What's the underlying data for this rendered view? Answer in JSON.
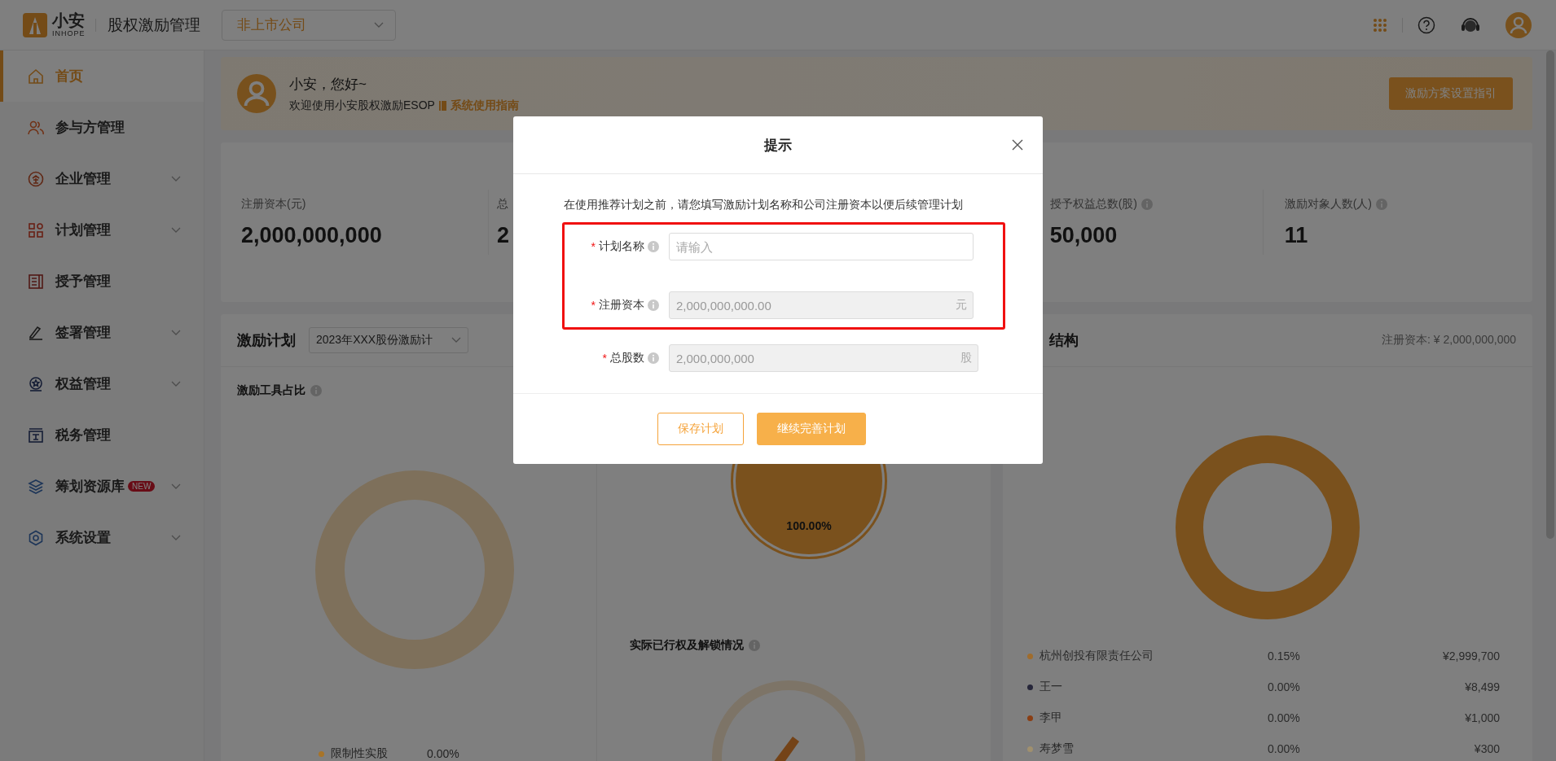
{
  "header": {
    "logo_text": "小安",
    "logo_subtext": "INHOPE",
    "title": "股权激励管理",
    "company_select": "非上市公司"
  },
  "sidebar": {
    "items": [
      {
        "label": "首页",
        "selected": true,
        "expandable": false
      },
      {
        "label": "参与方管理",
        "selected": false,
        "expandable": false
      },
      {
        "label": "企业管理",
        "selected": false,
        "expandable": true
      },
      {
        "label": "计划管理",
        "selected": false,
        "expandable": true
      },
      {
        "label": "授予管理",
        "selected": false,
        "expandable": false
      },
      {
        "label": "签署管理",
        "selected": false,
        "expandable": true
      },
      {
        "label": "权益管理",
        "selected": false,
        "expandable": true
      },
      {
        "label": "税务管理",
        "selected": false,
        "expandable": false
      },
      {
        "label": "筹划资源库",
        "badge": "NEW",
        "selected": false,
        "expandable": true
      },
      {
        "label": "系统设置",
        "selected": false,
        "expandable": true
      }
    ]
  },
  "banner": {
    "greeting": "小安，您好~",
    "welcome": "欢迎使用小安股权激励ESOP",
    "guide_link": "系统使用指南",
    "button": "激励方案设置指引"
  },
  "stats": [
    {
      "label": "注册资本(元)",
      "value": "2,000,000,000",
      "info": false
    },
    {
      "label": "总",
      "value": "2",
      "info": false
    },
    {
      "label": "授予权益总数(股)",
      "value": "50,000",
      "info": true
    },
    {
      "label": "激励对象人数(人)",
      "value": "11",
      "info": true
    }
  ],
  "plan_panel": {
    "title": "激励计划",
    "select": "2023年XXX股份激励计",
    "tool_ratio": {
      "title": "激励工具占比",
      "legend": [
        {
          "name": "限制性实股",
          "value": "0.00%",
          "color": "#a87428"
        }
      ]
    },
    "center_value": "100.00%",
    "exercise": {
      "title": "实际已行权及解锁情况"
    }
  },
  "structure_panel": {
    "title": "结构",
    "capital": "注册资本: ¥ 2,000,000,000",
    "legend": [
      {
        "name": "杭州创投有限责任公司",
        "share": "0.15%",
        "amount": "¥2,999,700",
        "color": "#a06c2c"
      },
      {
        "name": "王一",
        "share": "0.00%",
        "amount": "¥8,499",
        "color": "#26263a"
      },
      {
        "name": "李甲",
        "share": "0.00%",
        "amount": "¥1,000",
        "color": "#8a3e14"
      },
      {
        "name": "寿梦雪",
        "share": "0.00%",
        "amount": "¥300",
        "color": "#a0906e"
      }
    ]
  },
  "modal": {
    "title": "提示",
    "description": "在使用推荐计划之前，请您填写激励计划名称和公司注册资本以便后续管理计划",
    "fields": [
      {
        "label": "计划名称",
        "required_mark": "*",
        "placeholder": "请输入",
        "disabled": false,
        "highlighted": true
      },
      {
        "label": "注册资本",
        "required_mark": "*",
        "value": "2,000,000,000.00",
        "suffix": "元",
        "disabled": true,
        "highlighted": true
      },
      {
        "label": "总股数",
        "required_mark": "*",
        "value": "2,000,000,000",
        "suffix": "股",
        "disabled": true,
        "highlighted": false
      }
    ],
    "buttons": [
      {
        "label": "保存计划",
        "kind": "secondary"
      },
      {
        "label": "继续完善计划",
        "kind": "primary"
      }
    ]
  }
}
